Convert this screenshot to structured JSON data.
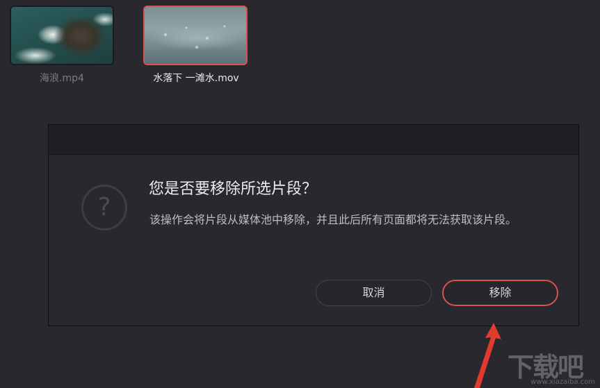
{
  "media_pool": {
    "clips": [
      {
        "name": "海浪.mp4",
        "selected": false
      },
      {
        "name": "水落下 一滩水.mov",
        "selected": true
      }
    ]
  },
  "dialog": {
    "icon": "question-mark-icon",
    "title": "您是否要移除所选片段？",
    "message": "该操作会将片段从媒体池中移除，并且此后所有页面都将无法获取该片段。",
    "buttons": {
      "cancel_label": "取消",
      "remove_label": "移除"
    }
  },
  "watermark": {
    "brand": "下载吧",
    "url": "www.xiazaiba.com"
  },
  "colors": {
    "accent": "#d8534e",
    "background": "#28282e",
    "annotation_arrow": "#e33a2f"
  }
}
